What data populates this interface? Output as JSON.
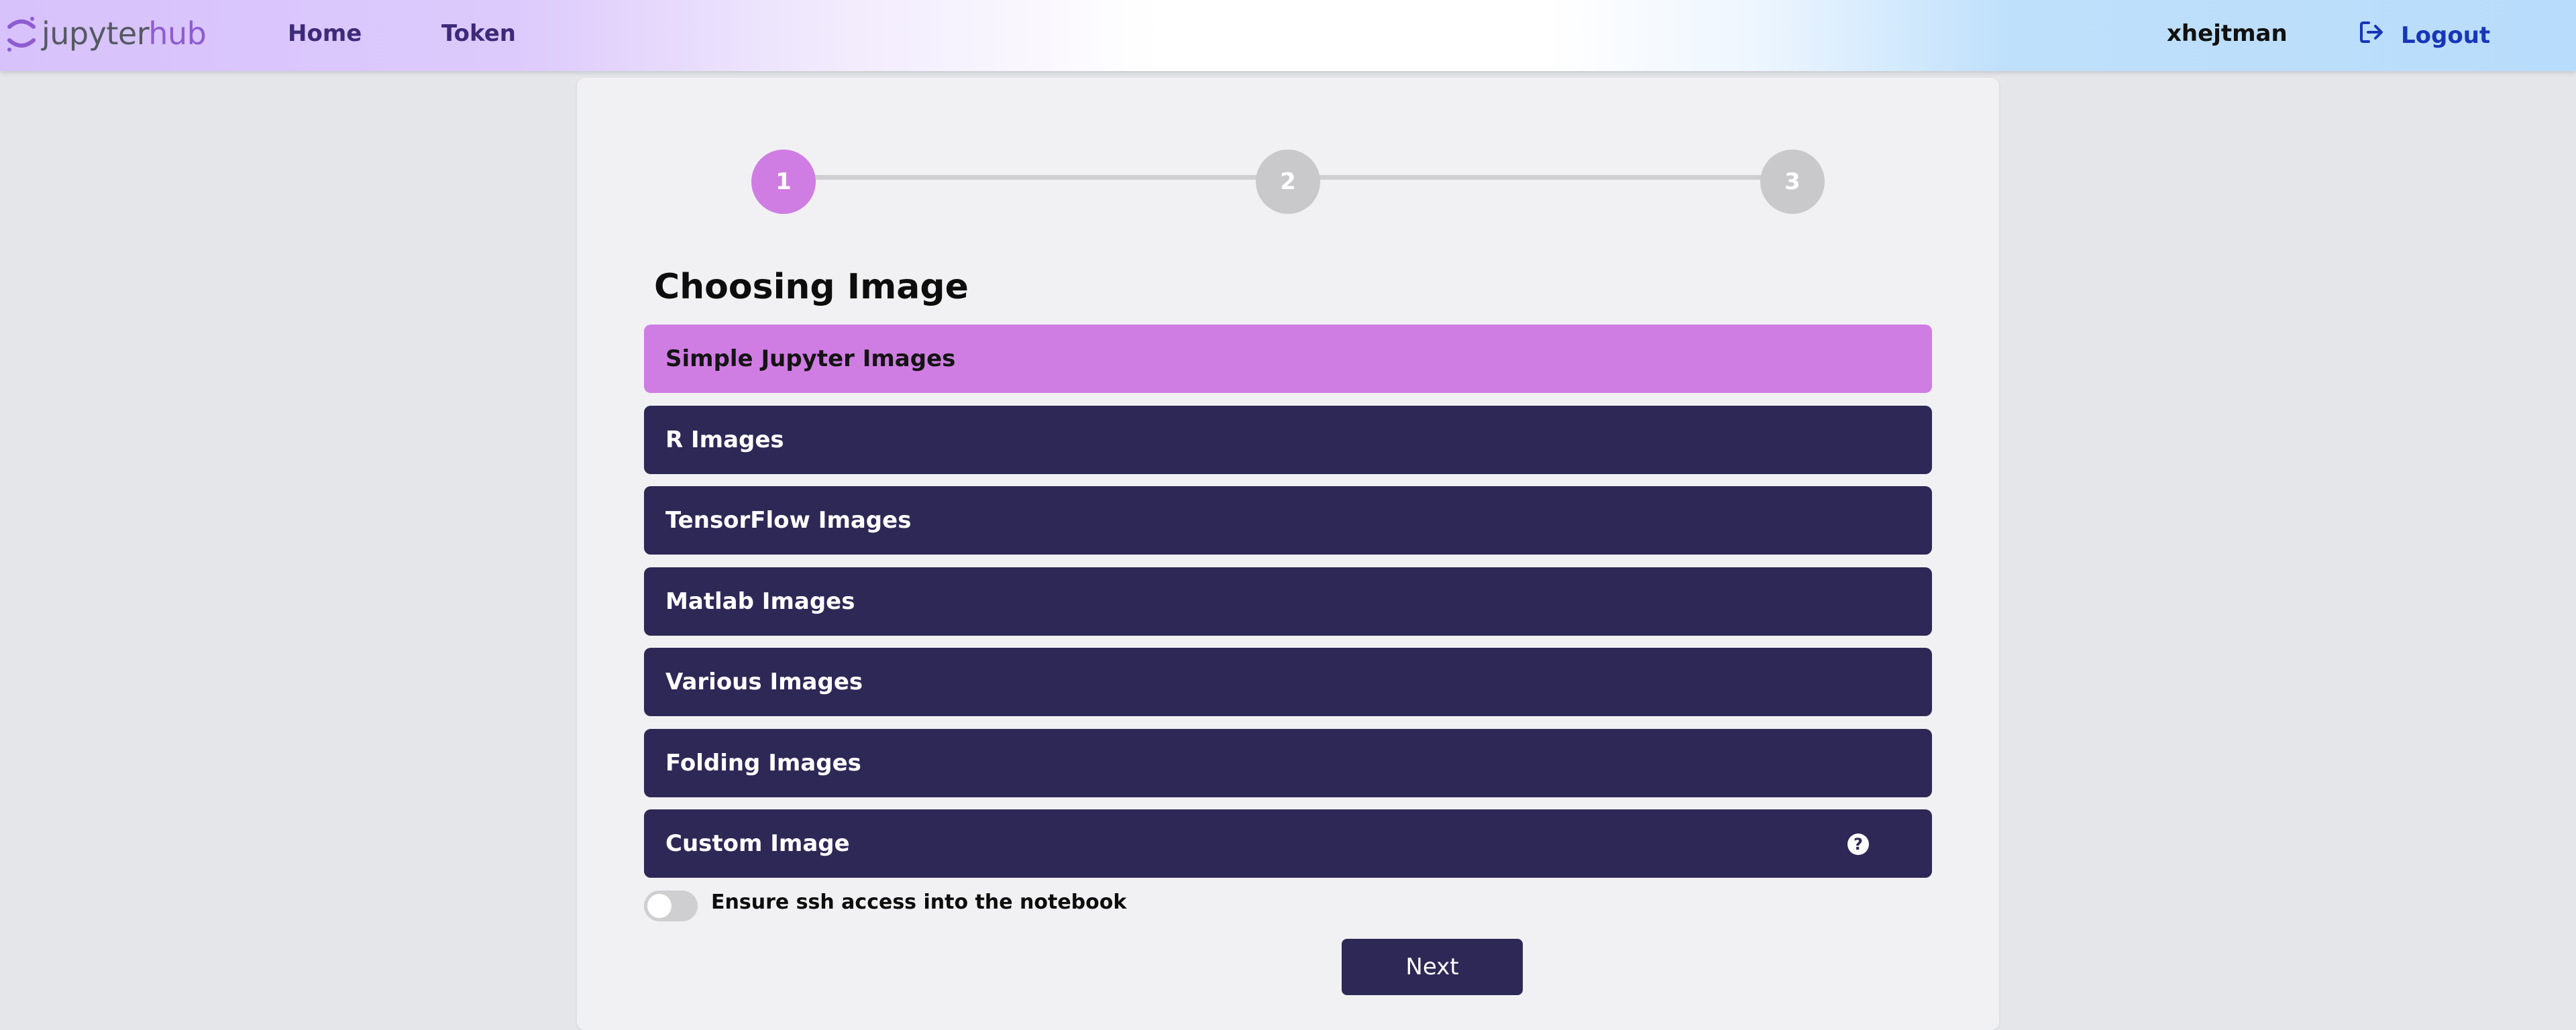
{
  "navbar": {
    "logo": {
      "part1": "jupyter",
      "part2": "hub"
    },
    "links": {
      "home": "Home",
      "token": "Token"
    },
    "username": "xhejtman",
    "logout_label": "Logout"
  },
  "stepper": {
    "steps": [
      "1",
      "2",
      "3"
    ],
    "active_step": 1
  },
  "section_title": "Choosing Image",
  "image_options": [
    {
      "label": "Simple Jupyter Images",
      "selected": true
    },
    {
      "label": "R Images",
      "selected": false
    },
    {
      "label": "TensorFlow Images",
      "selected": false
    },
    {
      "label": "Matlab Images",
      "selected": false
    },
    {
      "label": "Various Images",
      "selected": false
    },
    {
      "label": "Folding Images",
      "selected": false
    },
    {
      "label": "Custom Image",
      "selected": false,
      "help_icon": "?"
    }
  ],
  "ssh_toggle": {
    "label": "Ensure ssh access into the notebook",
    "enabled": false
  },
  "next_button_label": "Next",
  "colors": {
    "accent_pink": "#d07de3",
    "dark_navy": "#2e2856",
    "logout_blue": "#1736b8"
  }
}
